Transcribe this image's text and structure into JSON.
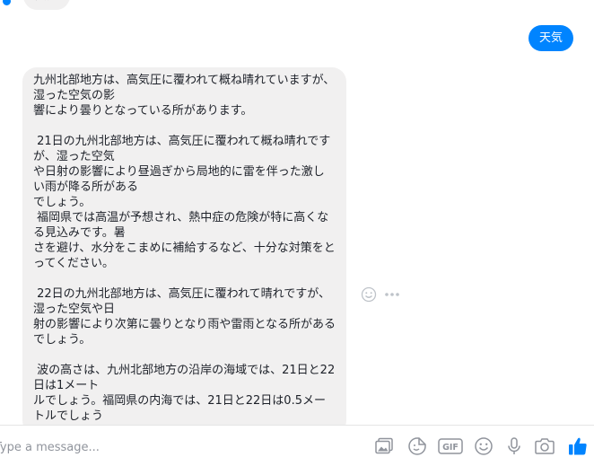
{
  "conversation": {
    "previous_message": "天気",
    "outgoing_message": "天気",
    "incoming_message": "九州北部地方は、高気圧に覆われて概ね晴れていますが、湿った空気の影\n響により曇りとなっている所があります。\n\n 21日の九州北部地方は、高気圧に覆われて概ね晴れですが、湿った空気\nや日射の影響により昼過ぎから局地的に雷を伴った激しい雨が降る所がある\nでしょう。\n 福岡県では高温が予想され、熱中症の危険が特に高くなる見込みです。暑\nさを避け、水分をこまめに補給するなど、十分な対策をとってください。\n\n 22日の九州北部地方は、高気圧に覆われて晴れですが、湿った空気や日\n射の影響により次第に曇りとなり雨や雷雨となる所があるでしょう。\n\n 波の高さは、九州北部地方の沿岸の海域では、21日と22日は1メート\nルでしょう。福岡県の内海では、21日と22日は0.5メートルでしょう"
  },
  "message_actions": {
    "icons": [
      "emoji-icon",
      "more-icon"
    ]
  },
  "composer": {
    "placeholder": "Type a message...",
    "tools": [
      "image-icon",
      "sticker-icon",
      "gif-icon",
      "emoji-icon",
      "microphone-icon",
      "camera-icon",
      "like-icon"
    ],
    "gif_label": "GIF"
  },
  "colors": {
    "accent": "#0084ff",
    "bubble_gray": "#f1f0f0",
    "icon_gray": "#90949c"
  }
}
